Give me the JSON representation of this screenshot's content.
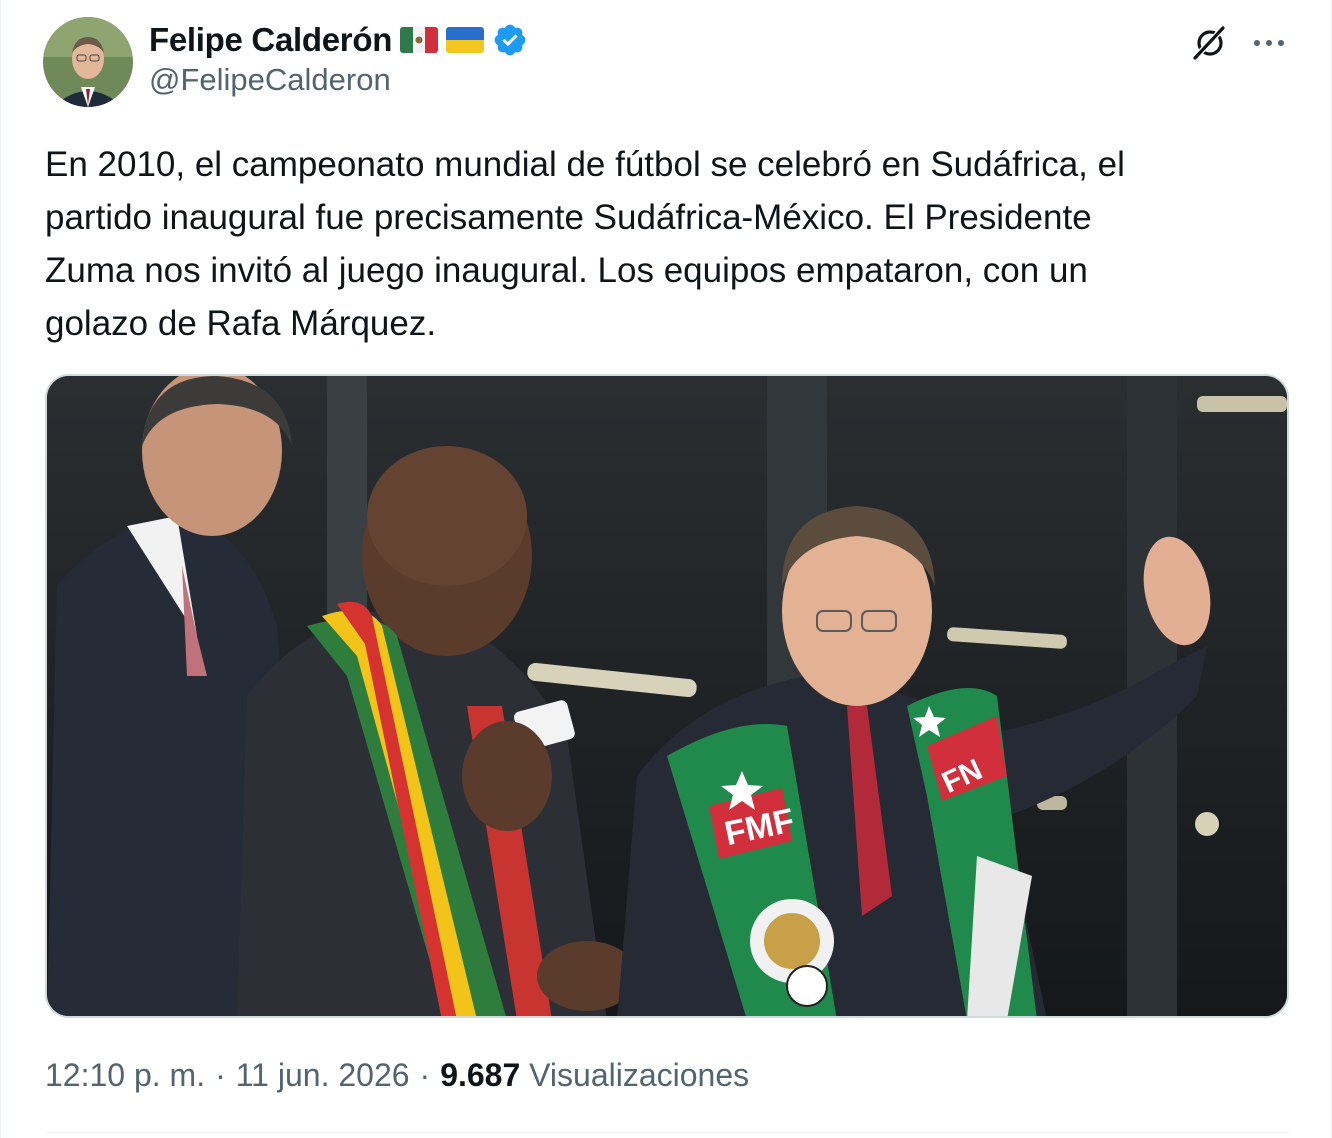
{
  "author": {
    "name": "Felipe Calderón",
    "handle": "@FelipeCalderon",
    "flags": [
      "mexico-flag",
      "ukraine-flag"
    ],
    "verified_badge_icon": "verified-badge-icon",
    "verified_color": "#1d9bf0"
  },
  "actions": {
    "grok_icon": "grok-icon",
    "more_icon": "more-options-icon"
  },
  "tweet": {
    "text": "En 2010, el campeonato mundial de fútbol se celebró en Sudáfrica, el\npartido inaugural fue precisamente Sudáfrica-México. El Presidente\nZuma nos invitó al juego inaugural. Los equipos empataron, con un\ngolazo de Rafa Márquez.",
    "media": {
      "scarf_text_left": "FMF",
      "scarf_text_right": "FN"
    }
  },
  "meta": {
    "time": "12:10 p. m.",
    "separator": "·",
    "date": "11 jun. 2026",
    "views_count": "9.687",
    "views_label": "Visualizaciones"
  },
  "colors": {
    "text_primary": "#0f1419",
    "text_secondary": "#536471",
    "border": "#cfd9de"
  }
}
